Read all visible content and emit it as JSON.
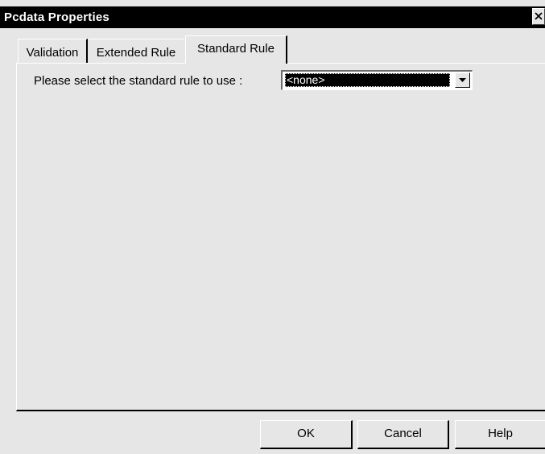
{
  "window": {
    "title": "Pcdata Properties"
  },
  "icons": {
    "close": "close-icon",
    "dropdown": "chevron-down-icon"
  },
  "tabs": [
    {
      "label": "Validation",
      "active": false
    },
    {
      "label": "Extended Rule",
      "active": false
    },
    {
      "label": "Standard Rule",
      "active": true
    }
  ],
  "panel": {
    "prompt": "Please select the standard rule to use :",
    "rule_select": {
      "value": "<none>"
    }
  },
  "buttons": {
    "ok": "OK",
    "cancel": "Cancel",
    "help": "Help"
  },
  "colors": {
    "titlebar": "#000000",
    "face": "#e6e6e6",
    "selection": "#000000"
  }
}
